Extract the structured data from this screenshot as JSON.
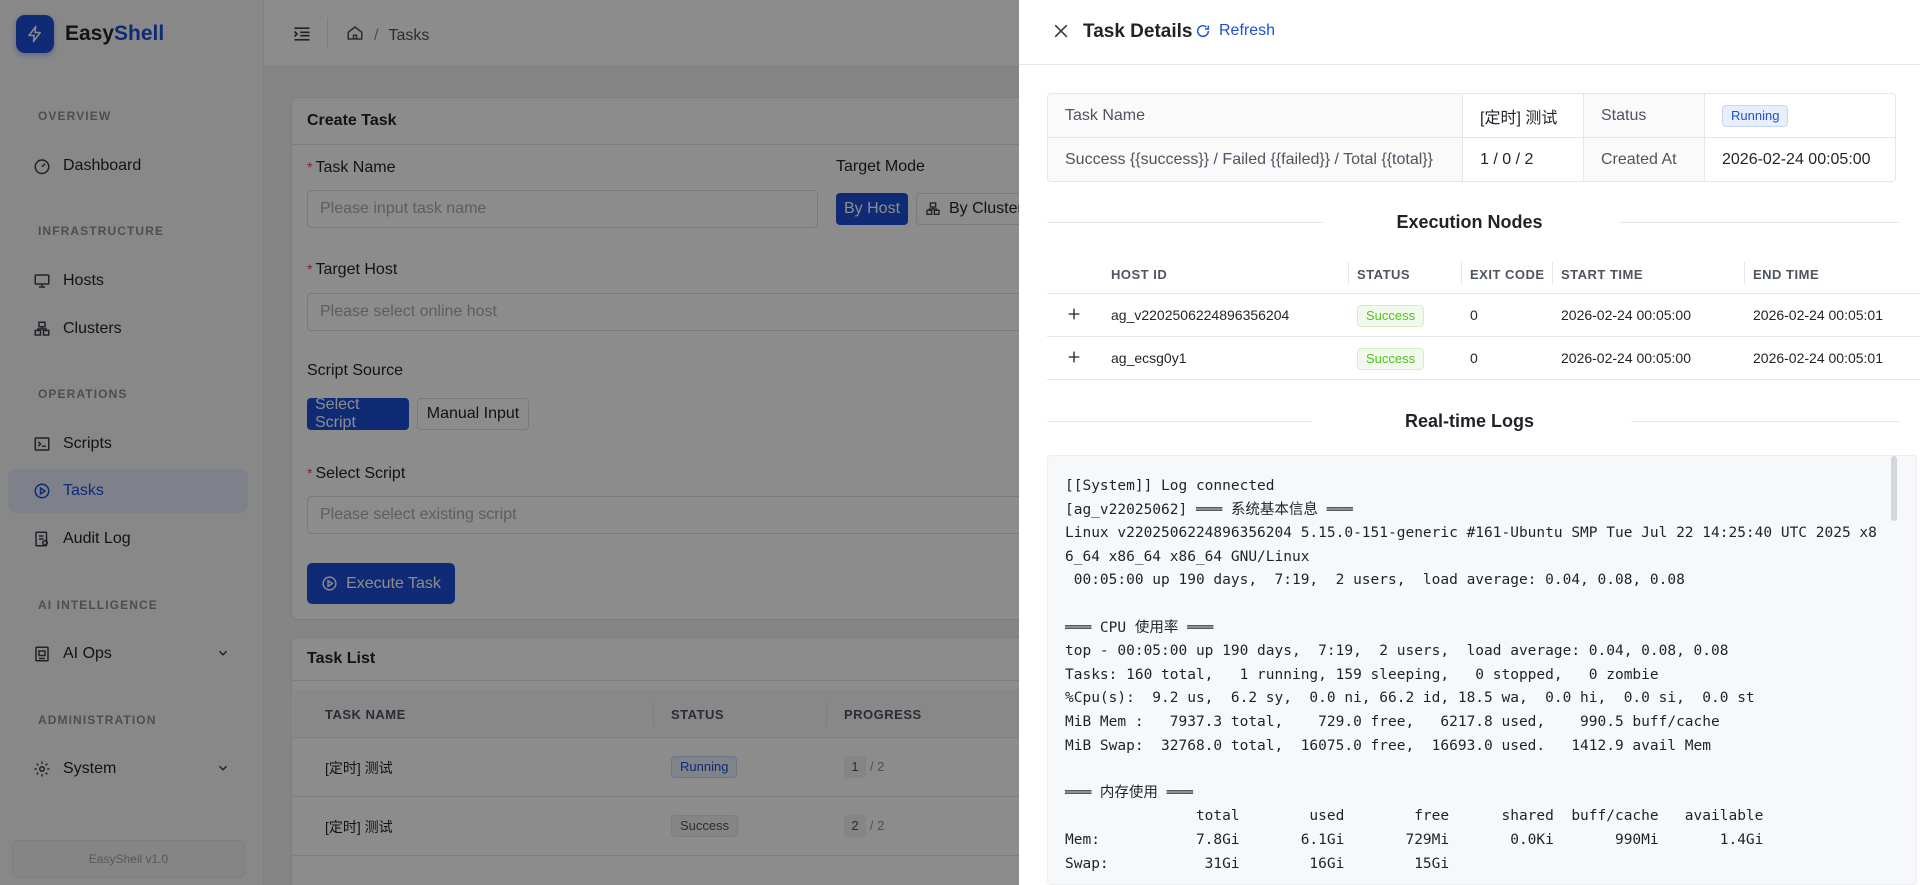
{
  "app": {
    "name_prefix": "Easy",
    "name_suffix": "Shell",
    "version": "EasyShell v1.0",
    "accent": "#1d4fd8"
  },
  "sidebar": {
    "sections": [
      "OVERVIEW",
      "INFRASTRUCTURE",
      "OPERATIONS",
      "AI INTELLIGENCE",
      "ADMINISTRATION"
    ],
    "items": [
      {
        "label": "Dashboard",
        "icon": "dashboard-icon"
      },
      {
        "label": "Hosts",
        "icon": "monitor-icon"
      },
      {
        "label": "Clusters",
        "icon": "cluster-icon"
      },
      {
        "label": "Scripts",
        "icon": "terminal-icon"
      },
      {
        "label": "Tasks",
        "icon": "play-circle-icon",
        "active": true
      },
      {
        "label": "Audit Log",
        "icon": "audit-icon"
      },
      {
        "label": "AI Ops",
        "icon": "robot-icon"
      },
      {
        "label": "System",
        "icon": "gear-icon"
      }
    ]
  },
  "breadcrumb": {
    "current": "Tasks",
    "separator": "/"
  },
  "create_task": {
    "title": "Create Task",
    "task_name_label": "Task Name",
    "task_name_placeholder": "Please input task name",
    "target_mode_label": "Target Mode",
    "by_host": "By Host",
    "by_cluster": "By Cluster",
    "target_host_label": "Target Host",
    "target_host_placeholder": "Please select online host",
    "script_source_label": "Script Source",
    "select_script_btn": "Select Script",
    "manual_input_btn": "Manual Input",
    "select_script_label": "Select Script",
    "select_script_placeholder": "Please select existing script",
    "execute_btn": "Execute Task",
    "required_mark": "*"
  },
  "task_list": {
    "title": "Task List",
    "columns": [
      "TASK NAME",
      "STATUS",
      "PROGRESS"
    ],
    "rows": [
      {
        "name": "[定时] 测试",
        "status": "Running",
        "progress_done": "1",
        "progress_total": "/ 2"
      },
      {
        "name": "[定时] 测试",
        "status": "Success",
        "progress_done": "2",
        "progress_total": "/ 2"
      }
    ]
  },
  "drawer": {
    "title": "Task Details",
    "refresh": "Refresh",
    "details": {
      "task_name_label": "Task Name",
      "task_name_value": "[定时] 测试",
      "status_label": "Status",
      "status_value": "Running",
      "summary_label": "Success {{success}} / Failed {{failed}} / Total {{total}}",
      "summary_value": "1 / 0 / 2",
      "created_label": "Created At",
      "created_value": "2026-02-24 00:05:00"
    },
    "nodes_title": "Execution Nodes",
    "nodes_columns": [
      "HOST ID",
      "STATUS",
      "EXIT CODE",
      "START TIME",
      "END TIME"
    ],
    "nodes": [
      {
        "host": "ag_v2202506224896356204",
        "status": "Success",
        "exit": "0",
        "start": "2026-02-24 00:05:00",
        "end": "2026-02-24 00:05:01"
      },
      {
        "host": "ag_ecsg0y1",
        "status": "Success",
        "exit": "0",
        "start": "2026-02-24 00:05:00",
        "end": "2026-02-24 00:05:01"
      }
    ],
    "logs_title": "Real-time Logs",
    "logs": [
      "[[System]] Log connected",
      "[ag_v22025062] ═══ 系统基本信息 ═══",
      "Linux v2202506224896356204 5.15.0-151-generic #161-Ubuntu SMP Tue Jul 22 14:25:40 UTC 2025 x8",
      "6_64 x86_64 x86_64 GNU/Linux",
      " 00:05:00 up 190 days,  7:19,  2 users,  load average: 0.04, 0.08, 0.08",
      "",
      "═══ CPU 使用率 ═══",
      "top - 00:05:00 up 190 days,  7:19,  2 users,  load average: 0.04, 0.08, 0.08",
      "Tasks: 160 total,   1 running, 159 sleeping,   0 stopped,   0 zombie",
      "%Cpu(s):  9.2 us,  6.2 sy,  0.0 ni, 66.2 id, 18.5 wa,  0.0 hi,  0.0 si,  0.0 st",
      "MiB Mem :   7937.3 total,    729.0 free,   6217.8 used,    990.5 buff/cache",
      "MiB Swap:  32768.0 total,  16075.0 free,  16693.0 used.   1412.9 avail Mem",
      "",
      "═══ 内存使用 ═══",
      "               total        used        free      shared  buff/cache   available",
      "Mem:           7.8Gi       6.1Gi       729Mi       0.0Ki       990Mi       1.4Gi",
      "Swap:           31Gi        16Gi        15Gi"
    ]
  }
}
